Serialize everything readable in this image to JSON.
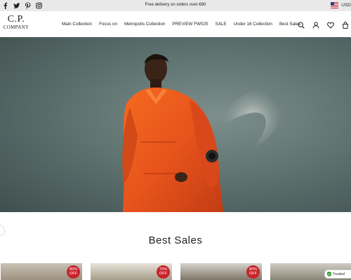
{
  "topbar": {
    "promo": "Free delivery on orders over €80",
    "currency": "USD",
    "social": [
      "facebook-icon",
      "twitter-icon",
      "pinterest-icon",
      "instagram-icon"
    ]
  },
  "header": {
    "logo_line1": "C.P.",
    "logo_line2": "COMPANY",
    "nav": [
      "Main Collection",
      "Focus on",
      "Metropolis Collection",
      "PREVIEW FW025",
      "SALE",
      "Under 16 Collection",
      "Best Sales"
    ],
    "icons": [
      "search-icon",
      "account-icon",
      "wishlist-icon",
      "cart-icon"
    ]
  },
  "section": {
    "title": "Best Sales"
  },
  "products": [
    {
      "discount": "80%",
      "off": "OFF"
    },
    {
      "discount": "75%",
      "off": "OFF"
    },
    {
      "discount": "80%",
      "off": "OFF"
    },
    {
      "discount": "",
      "off": ""
    }
  ],
  "trusted_badge": "Trusted",
  "colors": {
    "topbar_bg": "#e9e9e9",
    "badge_red": "#c8232c",
    "jacket_orange": "#e8541c",
    "hero_bg": "#5f7371"
  }
}
